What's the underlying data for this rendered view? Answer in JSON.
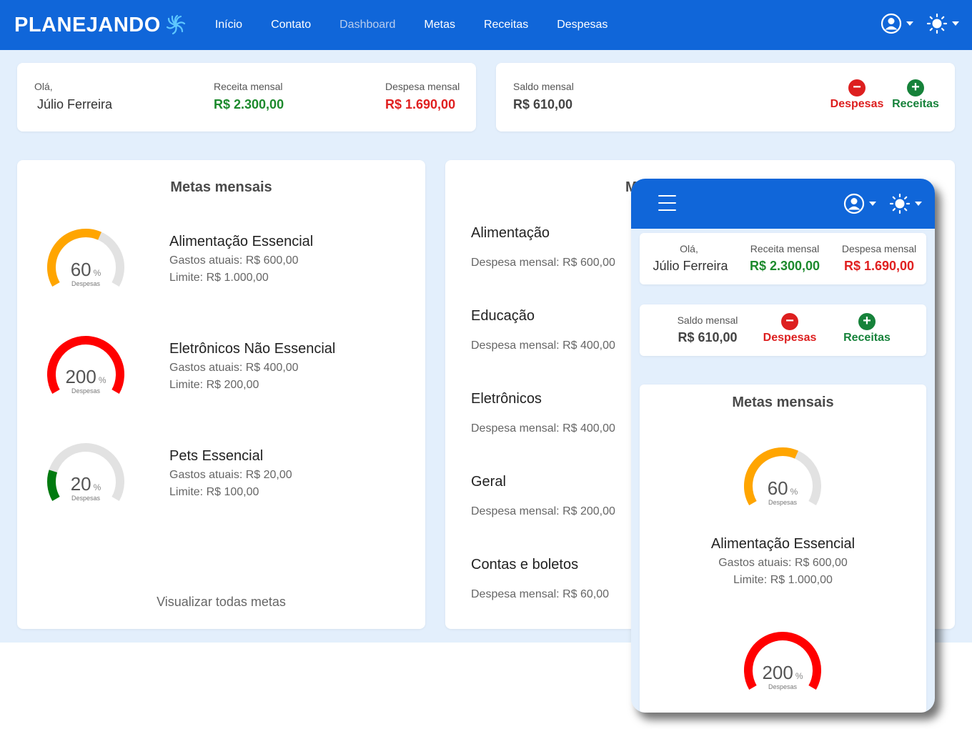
{
  "brand": {
    "name": "PLANEJANDO",
    "logo_icon": "spiral-icon",
    "color": "#1066d9"
  },
  "nav": {
    "links": [
      "Início",
      "Contato",
      "Dashboard",
      "Metas",
      "Receitas",
      "Despesas"
    ],
    "active": "Dashboard",
    "user_icon": "user-circle-icon",
    "theme_icon": "sun-icon"
  },
  "summary": {
    "greeting": "Olá,",
    "user_name": "Júlio Ferreira",
    "receita_label": "Receita mensal",
    "receita_value": "R$ 2.300,00",
    "despesa_label": "Despesa mensal",
    "despesa_value": "R$ 1.690,00",
    "saldo_label": "Saldo mensal",
    "saldo_value": "R$ 610,00",
    "btn_despesas": "Despesas",
    "btn_receitas": "Receitas"
  },
  "metas": {
    "title": "Metas mensais",
    "gauge_sub": "Despesas",
    "pct": "%",
    "items": [
      {
        "name": "Alimentação Essencial",
        "gastos": "Gastos atuais: R$ 600,00",
        "limite": "Limite: R$ 1.000,00",
        "percent": "60",
        "fraction": 0.6,
        "color": "#ffa500"
      },
      {
        "name": "Eletrônicos Não Essencial",
        "gastos": "Gastos atuais: R$ 400,00",
        "limite": "Limite: R$ 200,00",
        "percent": "200",
        "fraction": 1.0,
        "color": "#ff0000"
      },
      {
        "name": "Pets Essencial",
        "gastos": "Gastos atuais: R$ 20,00",
        "limite": "Limite: R$ 100,00",
        "percent": "20",
        "fraction": 0.2,
        "color": "#007a0f"
      }
    ],
    "view_all": "Visualizar todas metas"
  },
  "categorias": {
    "title_partial": "M",
    "items": [
      {
        "name": "Alimentação",
        "despesa": "Despesa mensal: R$ 600,00"
      },
      {
        "name": "Educação",
        "despesa": "Despesa mensal: R$ 400,00"
      },
      {
        "name": "Eletrônicos",
        "despesa": "Despesa mensal: R$ 400,00"
      },
      {
        "name": "Geral",
        "despesa": "Despesa mensal: R$ 200,00"
      },
      {
        "name": "Contas e boletos",
        "despesa": "Despesa mensal: R$ 60,00"
      }
    ]
  },
  "mobile": {
    "menu_icon": "hamburger-icon"
  }
}
